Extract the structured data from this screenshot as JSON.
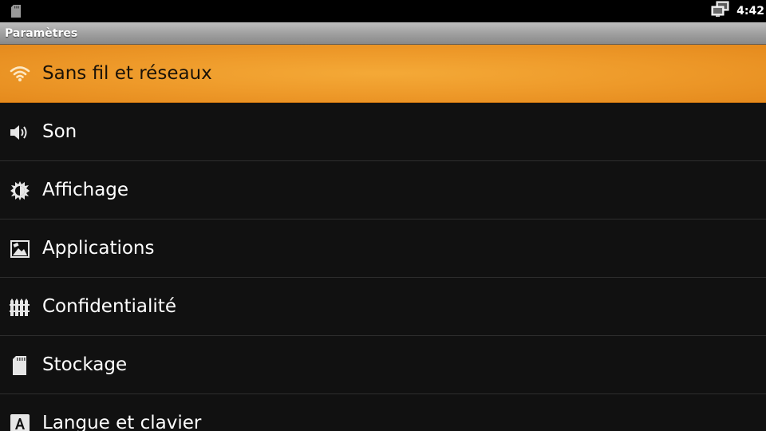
{
  "status_bar": {
    "time": "4:42",
    "icons": [
      "sd-card-icon",
      "network-icon"
    ]
  },
  "header": {
    "title": "Paramètres"
  },
  "settings": {
    "items": [
      {
        "label": "Sans fil et réseaux",
        "icon": "wifi-icon",
        "selected": true
      },
      {
        "label": "Son",
        "icon": "speaker-icon"
      },
      {
        "label": "Affichage",
        "icon": "brightness-icon"
      },
      {
        "label": "Applications",
        "icon": "applications-icon"
      },
      {
        "label": "Confidentialité",
        "icon": "privacy-icon"
      },
      {
        "label": "Stockage",
        "icon": "sd-card-icon"
      },
      {
        "label": "Langue et clavier",
        "icon": "keyboard-icon"
      }
    ]
  },
  "colors": {
    "selected_highlight": "#EE9A2A",
    "background": "#111111",
    "title_bar": "#9E9E9E"
  }
}
